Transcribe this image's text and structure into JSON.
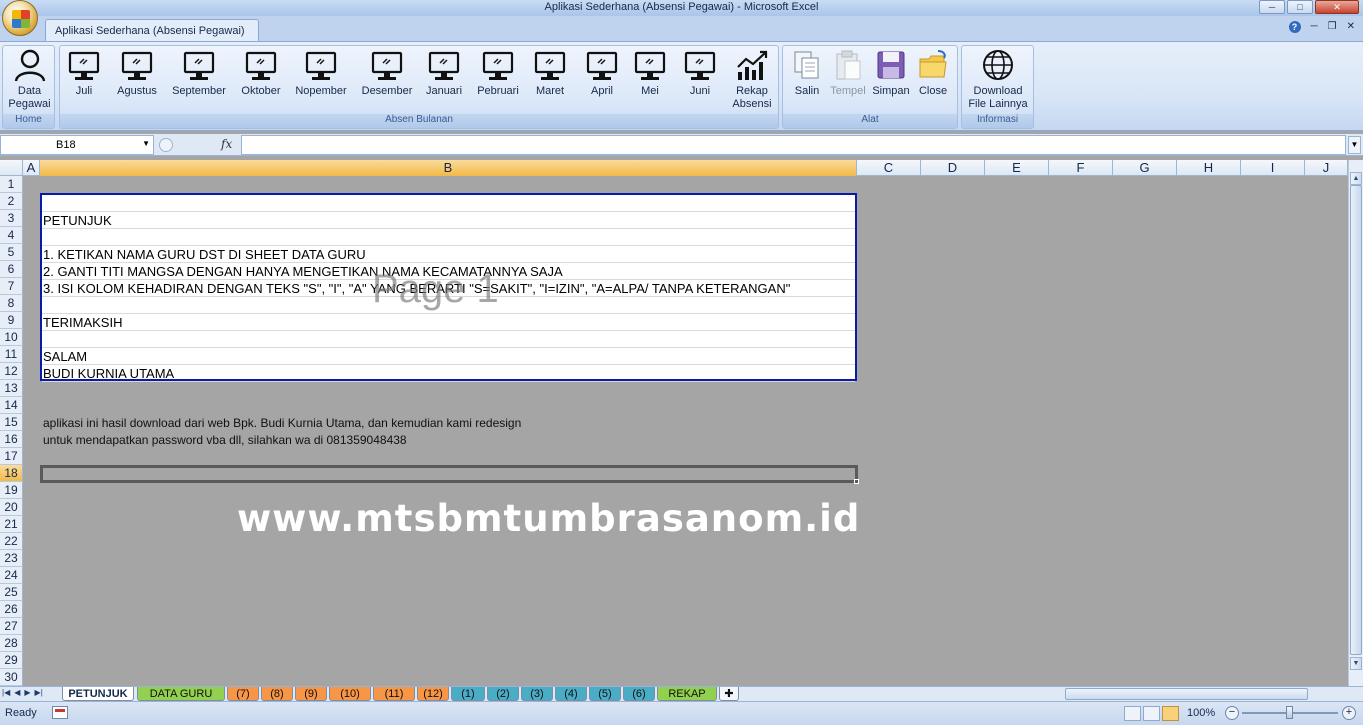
{
  "window": {
    "title": "Aplikasi Sederhana (Absensi Pegawai) - Microsoft Excel",
    "minimize": "─",
    "maximize": "□",
    "close": "✕"
  },
  "ribbon": {
    "active_tab": "Aplikasi Sederhana (Absensi Pegawai)",
    "help_icon": "?",
    "groups": {
      "home": {
        "label": "Home",
        "buttons": [
          {
            "label1": "Data",
            "label2": "Pegawai",
            "icon": "person-icon"
          }
        ]
      },
      "absen": {
        "label": "Absen Bulanan",
        "months": [
          "Juli",
          "Agustus",
          "September",
          "Oktober",
          "Nopember",
          "Desember",
          "Januari",
          "Pebruari",
          "Maret",
          "April",
          "Mei",
          "Juni"
        ],
        "rekap": {
          "label1": "Rekap",
          "label2": "Absensi",
          "icon": "chart-icon"
        }
      },
      "alat": {
        "label": "Alat",
        "buttons": [
          {
            "label": "Salin",
            "icon": "copy-icon",
            "enabled": true
          },
          {
            "label": "Tempel",
            "icon": "paste-icon",
            "enabled": false
          },
          {
            "label": "Simpan",
            "icon": "save-icon",
            "enabled": true
          },
          {
            "label": "Close",
            "icon": "folder-close-icon",
            "enabled": true
          }
        ]
      },
      "informasi": {
        "label": "Informasi",
        "download": {
          "label1": "Download",
          "label2": "File Lainnya",
          "icon": "globe-icon"
        }
      }
    }
  },
  "formula_bar": {
    "name_box": "B18",
    "fx": "fx",
    "value": ""
  },
  "grid": {
    "columns": [
      "A",
      "B",
      "C",
      "D",
      "E",
      "F",
      "G",
      "H",
      "I",
      "J"
    ],
    "selected_column": "B",
    "rows": [
      "1",
      "2",
      "3",
      "4",
      "5",
      "6",
      "7",
      "8",
      "9",
      "10",
      "11",
      "12",
      "13",
      "14",
      "15",
      "16",
      "17",
      "18",
      "19",
      "20",
      "21",
      "22",
      "23",
      "24",
      "25",
      "26",
      "27",
      "28",
      "29",
      "30"
    ],
    "selected_row": "18"
  },
  "content": {
    "box_lines": [
      "",
      "PETUNJUK",
      "",
      "1. KETIKAN NAMA GURU DST DI SHEET DATA GURU",
      "2. GANTI TITI MANGSA DENGAN HANYA MENGETIKAN NAMA KECAMATANNYA SAJA",
      "3. ISI KOLOM KEHADIRAN DENGAN TEKS \"S\", \"I\", \"A\" YANG BERARTI  \"S=SAKIT\", \"I=IZIN\", \"A=ALPA/ TANPA KETERANGAN\"",
      "",
      "TERIMAKSIH",
      "",
      "SALAM",
      "BUDI KURNIA UTAMA"
    ],
    "page_watermark": "Page 1",
    "note_line1": "aplikasi ini hasil download dari web Bpk. Budi Kurnia Utama, dan kemudian kami redesign",
    "note_line2": "untuk mendapatkan password vba dll, silahkan wa di 081359048438",
    "web_watermark": "www.mtsbmtumbrasanom.id"
  },
  "sheet_tabs": [
    {
      "label": "PETUNJUK",
      "color": "#ffffff",
      "active": true
    },
    {
      "label": "DATA GURU",
      "color": "#92d050",
      "active": false
    },
    {
      "label": "(7)",
      "color": "#f79646",
      "active": false
    },
    {
      "label": "(8)",
      "color": "#f79646",
      "active": false
    },
    {
      "label": "(9)",
      "color": "#f79646",
      "active": false
    },
    {
      "label": "(10)",
      "color": "#f79646",
      "active": false
    },
    {
      "label": "(11)",
      "color": "#f79646",
      "active": false
    },
    {
      "label": "(12)",
      "color": "#f79646",
      "active": false
    },
    {
      "label": "(1)",
      "color": "#4bacc6",
      "active": false
    },
    {
      "label": "(2)",
      "color": "#4bacc6",
      "active": false
    },
    {
      "label": "(3)",
      "color": "#4bacc6",
      "active": false
    },
    {
      "label": "(4)",
      "color": "#4bacc6",
      "active": false
    },
    {
      "label": "(5)",
      "color": "#4bacc6",
      "active": false
    },
    {
      "label": "(6)",
      "color": "#4bacc6",
      "active": false
    },
    {
      "label": "REKAP",
      "color": "#92d050",
      "active": false
    }
  ],
  "status_bar": {
    "status": "Ready",
    "zoom": "100%",
    "zoom_minus": "−",
    "zoom_plus": "+"
  }
}
